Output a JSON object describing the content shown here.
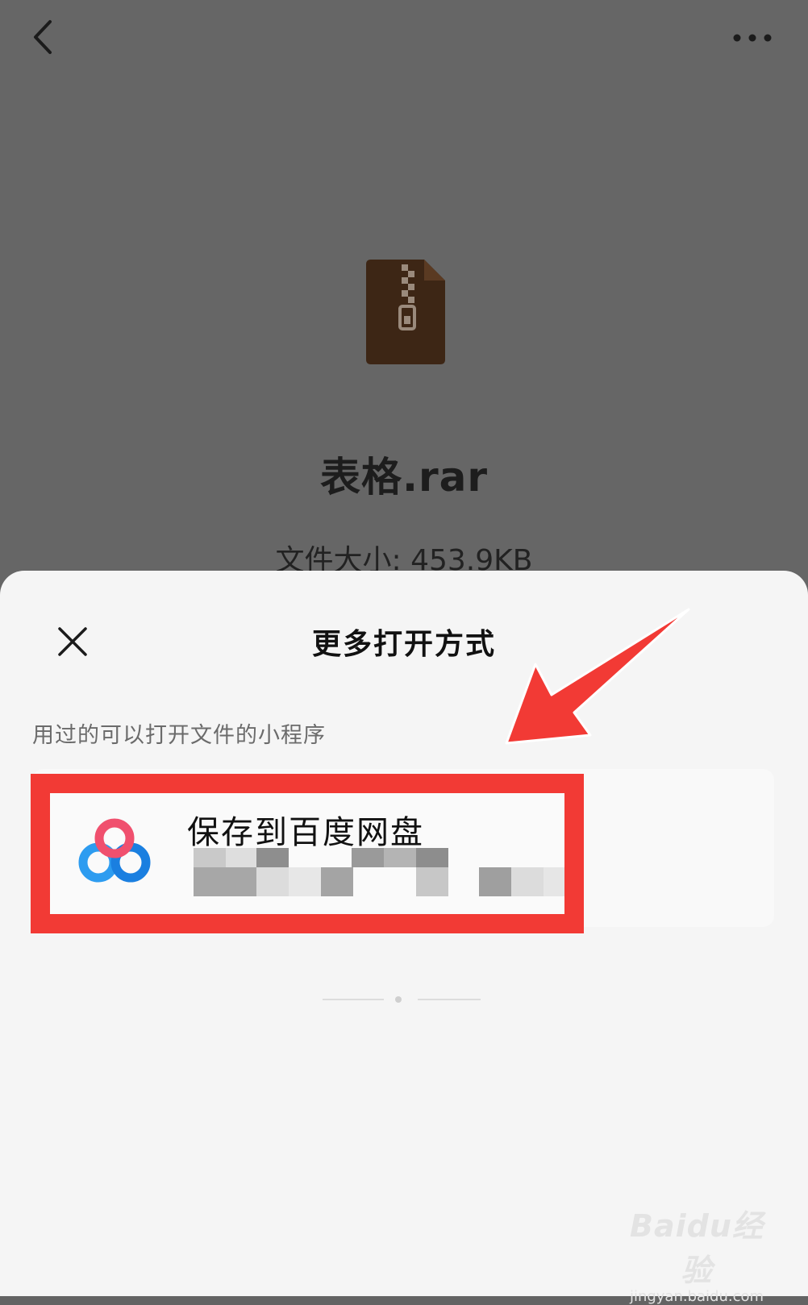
{
  "file": {
    "name": "表格.rar",
    "size_text": "文件大小: 453.9KB",
    "icon": "zip-archive-icon"
  },
  "toolbar": {
    "back_icon": "chevron-left-icon",
    "more_icon": "more-horizontal-icon"
  },
  "sheet": {
    "title": "更多打开方式",
    "close_icon": "close-icon",
    "section_label": "用过的可以打开文件的小程序",
    "items": [
      {
        "title": "保存到百度网盘",
        "icon": "baidu-netdisk-icon"
      }
    ]
  },
  "annotation": {
    "highlight_color": "#f23a35",
    "arrow_color": "#f23a35"
  },
  "watermark": {
    "logo": "Baidu经验",
    "url": "jingyan.baidu.com"
  }
}
